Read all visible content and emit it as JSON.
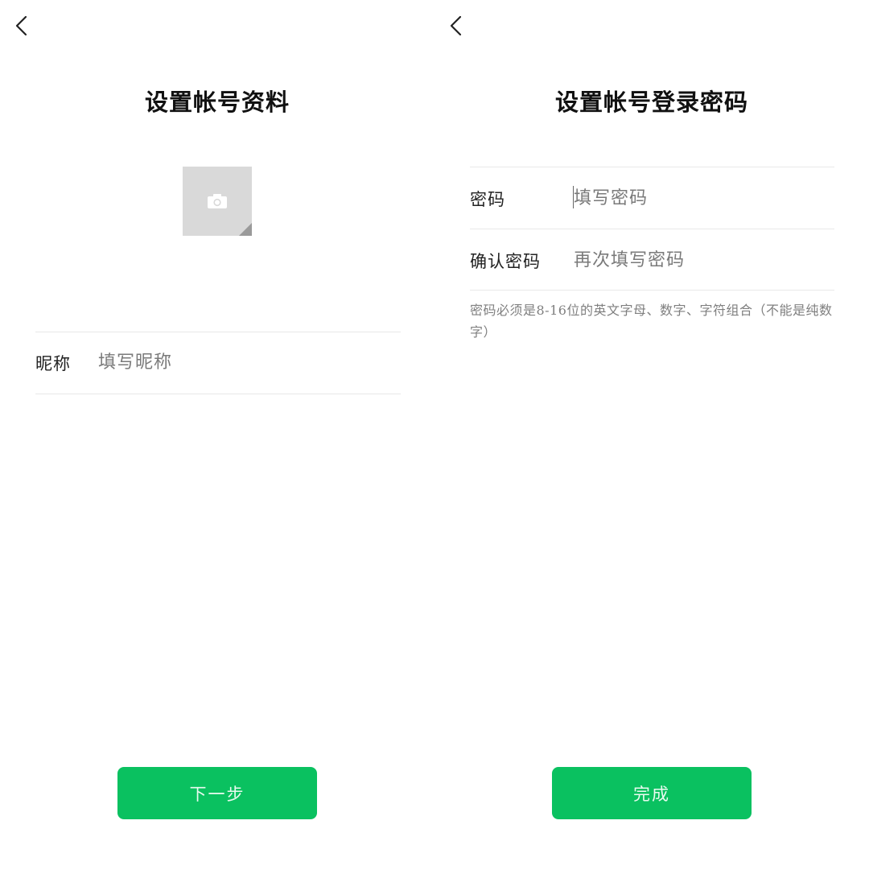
{
  "accent_color": "#0ac160",
  "left_screen": {
    "back_icon": "chevron-left-icon",
    "title": "设置帐号资料",
    "avatar_icon": "camera-icon",
    "nickname": {
      "label": "昵称",
      "placeholder": "填写昵称",
      "value": ""
    },
    "next_button_label": "下一步"
  },
  "right_screen": {
    "back_icon": "chevron-left-icon",
    "title": "设置帐号登录密码",
    "password": {
      "label": "密码",
      "placeholder": "填写密码",
      "value": ""
    },
    "confirm_password": {
      "label": "确认密码",
      "placeholder": "再次填写密码",
      "value": ""
    },
    "hint": "密码必须是8-16位的英文字母、数字、字符组合（不能是纯数字）",
    "done_button_label": "完成"
  }
}
